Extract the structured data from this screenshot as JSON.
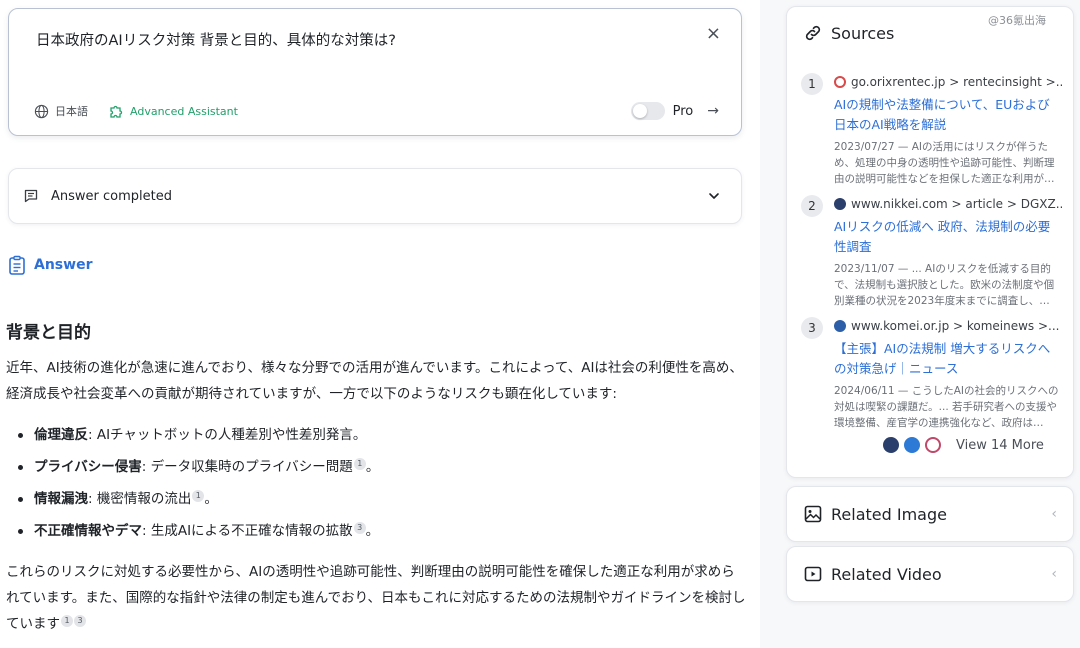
{
  "query": {
    "text": "日本政府のAIリスク対策 背景と目的、具体的な対策は?",
    "close_symbol": "×",
    "language": "日本語",
    "assistant": "Advanced Assistant",
    "pro_label": "Pro",
    "pro_enabled": false,
    "send_symbol": "→"
  },
  "status": {
    "text": "Answer completed"
  },
  "answer": {
    "label": "Answer",
    "heading": "背景と目的",
    "para1": "近年、AI技術の進化が急速に進んでおり、様々な分野での活用が進んでいます。これによって、AIは社会の利便性を高め、経済成長や社会変革への貢献が期待されていますが、一方で以下のようなリスクも顕在化しています:",
    "bullets": [
      {
        "term": "倫理違反",
        "text": ": AIチャットボットの人種差別や性差別発言。",
        "cites": []
      },
      {
        "term": "プライバシー侵害",
        "text": ": データ収集時のプライバシー問題",
        "cites": [
          "1"
        ],
        "tail": "。"
      },
      {
        "term": "情報漏洩",
        "text": ": 機密情報の流出",
        "cites": [
          "1"
        ],
        "tail": "。"
      },
      {
        "term": "不正確情報やデマ",
        "text": ": 生成AIによる不正確な情報の拡散",
        "cites": [
          "3"
        ],
        "tail": "。"
      }
    ],
    "para2": "これらのリスクに対処する必要性から、AIの透明性や追跡可能性、判断理由の説明可能性を確保した適正な利用が求められています。また、国際的な指針や法律の制定も進んでおり、日本もこれに対応するための法規制やガイドラインを検討しています",
    "para2_cites": [
      "1",
      "3"
    ]
  },
  "sidebar": {
    "watermark": "@36氪出海",
    "sources_title": "Sources",
    "sources": [
      {
        "num": "1",
        "domain": "go.orixrentec.jp > rentecinsight >...",
        "title": "AIの規制や法整備について、EUおよび日本のAI戦略を解説",
        "snippet": "2023/07/27 — AIの活用にはリスクが伴うため、処理の中身の透明性や追跡可能性、判断理由の説明可能性などを担保した適正な利用が…",
        "favicon_color": "#d94a4a"
      },
      {
        "num": "2",
        "domain": "www.nikkei.com > article > DGXZ...",
        "title": "AIリスクの低減へ 政府、法規制の必要性調査",
        "snippet": "2023/11/07 — ... AIのリスクを低減する目的で、法規制も選択肢とした。欧米の法制度や個別業種の状況を2023年度末までに調査し、…",
        "favicon_color": "#2a3f6b"
      },
      {
        "num": "3",
        "domain": "www.komei.or.jp > komeinews >...",
        "title": "【主張】AIの法規制 増大するリスクへの対策急げ｜ニュース",
        "snippet": "2024/06/11 — こうしたAIの社会的リスクへの対処は喫緊の課題だ。... 若手研究者への支援や環境整備、産官学の連携強化など、政府は…",
        "favicon_color": "#2d5fa8"
      }
    ],
    "view_more": "View 14 More",
    "more_icon_colors": [
      "#2a3f6b",
      "#2c7ad6",
      "#c0486a"
    ],
    "related_image": "Related Image",
    "related_video": "Related Video"
  }
}
